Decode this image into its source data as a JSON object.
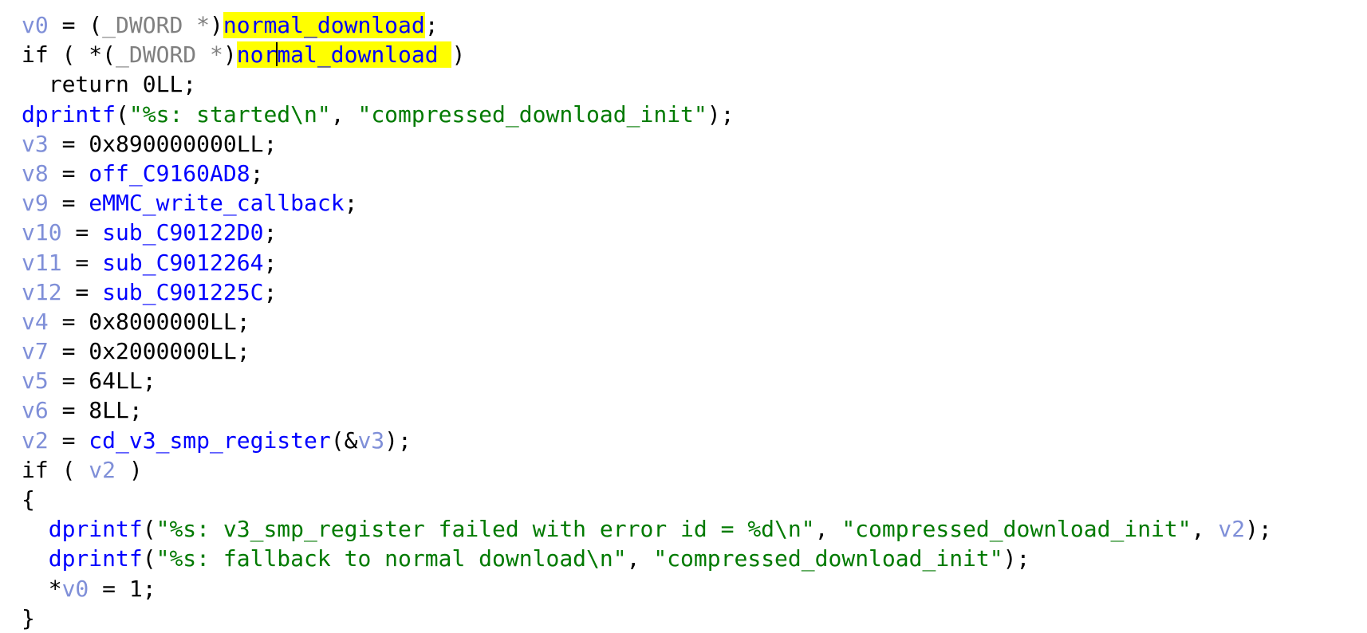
{
  "colors": {
    "background": "#ffffff",
    "variable": "#7f8fd8",
    "cast": "#808080",
    "symbol": "#0000ff",
    "string": "#007a00",
    "plain": "#000000",
    "highlight": "#ffff00"
  },
  "caret": {
    "line": 1,
    "token": 3,
    "offset": 3
  },
  "lines": [
    [
      {
        "t": "v0",
        "c": "var"
      },
      {
        "t": " = ",
        "c": "plain"
      },
      {
        "t": "(",
        "c": "plain"
      },
      {
        "t": "_DWORD *",
        "c": "cast"
      },
      {
        "t": ")",
        "c": "plain"
      },
      {
        "t": "normal_download",
        "c": "hl"
      },
      {
        "t": ";",
        "c": "plain"
      }
    ],
    [
      {
        "t": "if ( *(",
        "c": "plain"
      },
      {
        "t": "_DWORD *",
        "c": "cast"
      },
      {
        "t": ")",
        "c": "plain"
      },
      {
        "t": "normal_download",
        "c": "hl"
      },
      {
        "t": " ",
        "c": "hl"
      },
      {
        "t": ")",
        "c": "plain"
      }
    ],
    [
      {
        "t": "  return 0LL;",
        "c": "plain"
      }
    ],
    [
      {
        "t": "dprintf",
        "c": "sym"
      },
      {
        "t": "(",
        "c": "plain"
      },
      {
        "t": "\"%s: started\\n\"",
        "c": "str"
      },
      {
        "t": ", ",
        "c": "plain"
      },
      {
        "t": "\"compressed_download_init\"",
        "c": "str"
      },
      {
        "t": ");",
        "c": "plain"
      }
    ],
    [
      {
        "t": "v3",
        "c": "var"
      },
      {
        "t": " = 0x890000000LL;",
        "c": "plain"
      }
    ],
    [
      {
        "t": "v8",
        "c": "var"
      },
      {
        "t": " = ",
        "c": "plain"
      },
      {
        "t": "off_C9160AD8",
        "c": "sym"
      },
      {
        "t": ";",
        "c": "plain"
      }
    ],
    [
      {
        "t": "v9",
        "c": "var"
      },
      {
        "t": " = ",
        "c": "plain"
      },
      {
        "t": "eMMC_write_callback",
        "c": "sym"
      },
      {
        "t": ";",
        "c": "plain"
      }
    ],
    [
      {
        "t": "v10",
        "c": "var"
      },
      {
        "t": " = ",
        "c": "plain"
      },
      {
        "t": "sub_C90122D0",
        "c": "sym"
      },
      {
        "t": ";",
        "c": "plain"
      }
    ],
    [
      {
        "t": "v11",
        "c": "var"
      },
      {
        "t": " = ",
        "c": "plain"
      },
      {
        "t": "sub_C9012264",
        "c": "sym"
      },
      {
        "t": ";",
        "c": "plain"
      }
    ],
    [
      {
        "t": "v12",
        "c": "var"
      },
      {
        "t": " = ",
        "c": "plain"
      },
      {
        "t": "sub_C901225C",
        "c": "sym"
      },
      {
        "t": ";",
        "c": "plain"
      }
    ],
    [
      {
        "t": "v4",
        "c": "var"
      },
      {
        "t": " = 0x8000000LL;",
        "c": "plain"
      }
    ],
    [
      {
        "t": "v7",
        "c": "var"
      },
      {
        "t": " = 0x2000000LL;",
        "c": "plain"
      }
    ],
    [
      {
        "t": "v5",
        "c": "var"
      },
      {
        "t": " = 64LL;",
        "c": "plain"
      }
    ],
    [
      {
        "t": "v6",
        "c": "var"
      },
      {
        "t": " = 8LL;",
        "c": "plain"
      }
    ],
    [
      {
        "t": "v2",
        "c": "var"
      },
      {
        "t": " = ",
        "c": "plain"
      },
      {
        "t": "cd_v3_smp_register",
        "c": "sym"
      },
      {
        "t": "(&",
        "c": "plain"
      },
      {
        "t": "v3",
        "c": "var"
      },
      {
        "t": ");",
        "c": "plain"
      }
    ],
    [
      {
        "t": "if ( ",
        "c": "plain"
      },
      {
        "t": "v2",
        "c": "var"
      },
      {
        "t": " )",
        "c": "plain"
      }
    ],
    [
      {
        "t": "{",
        "c": "plain"
      }
    ],
    [
      {
        "t": "  ",
        "c": "plain"
      },
      {
        "t": "dprintf",
        "c": "sym"
      },
      {
        "t": "(",
        "c": "plain"
      },
      {
        "t": "\"%s: v3_smp_register failed with error id = %d\\n\"",
        "c": "str"
      },
      {
        "t": ", ",
        "c": "plain"
      },
      {
        "t": "\"compressed_download_init\"",
        "c": "str"
      },
      {
        "t": ", ",
        "c": "plain"
      },
      {
        "t": "v2",
        "c": "var"
      },
      {
        "t": ");",
        "c": "plain"
      }
    ],
    [
      {
        "t": "  ",
        "c": "plain"
      },
      {
        "t": "dprintf",
        "c": "sym"
      },
      {
        "t": "(",
        "c": "plain"
      },
      {
        "t": "\"%s: fallback to normal download\\n\"",
        "c": "str"
      },
      {
        "t": ", ",
        "c": "plain"
      },
      {
        "t": "\"compressed_download_init\"",
        "c": "str"
      },
      {
        "t": ");",
        "c": "plain"
      }
    ],
    [
      {
        "t": "  *",
        "c": "plain"
      },
      {
        "t": "v0",
        "c": "var"
      },
      {
        "t": " = 1;",
        "c": "plain"
      }
    ],
    [
      {
        "t": "}",
        "c": "plain"
      }
    ]
  ]
}
